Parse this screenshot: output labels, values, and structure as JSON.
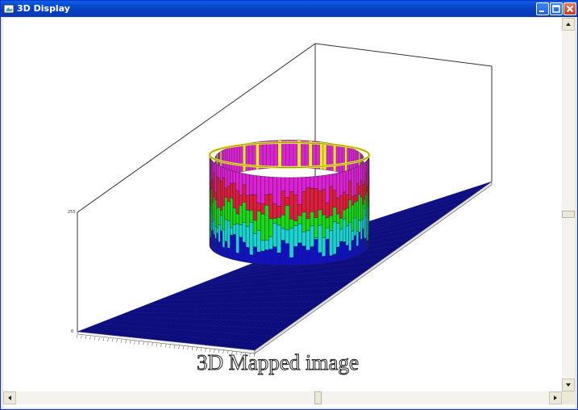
{
  "window": {
    "title": "3D Display",
    "minimize_icon": "minimize-icon",
    "maximize_icon": "maximize-icon",
    "close_icon": "close-icon"
  },
  "plot": {
    "caption": "3D Mapped image",
    "z_tick_top": "255",
    "z_tick_bottom": "0",
    "surface_colors": [
      "#1010c8",
      "#19d2d2",
      "#18d818",
      "#e01c3c",
      "#e020d8",
      "#f0e828"
    ],
    "base_color": "#0b0b7a"
  },
  "scrollbars": {
    "vertical": "vertical-scrollbar",
    "horizontal": "horizontal-scrollbar"
  },
  "colors": {
    "titlebar": "#0842c6",
    "frame": "#ece9d8",
    "close_button": "#c7391c"
  }
}
